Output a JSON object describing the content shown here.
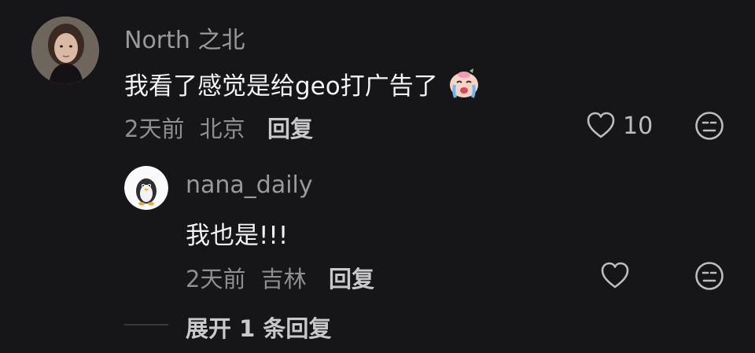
{
  "comments": [
    {
      "username": "North 之北",
      "text": "我看了感觉是给geo打广告了",
      "emoji_icon": "crying-face-emoji-icon",
      "time": "2天前",
      "location": "北京",
      "reply_label": "回复",
      "like_count": "10",
      "icons": {
        "like": "heart-outline-icon",
        "more": "expressionless-face-icon"
      }
    }
  ],
  "replies": [
    {
      "username": "nana_daily",
      "text": "我也是!!!",
      "time": "2天前",
      "location": "吉林",
      "reply_label": "回复",
      "icons": {
        "avatar": "penguin-icon",
        "like": "heart-outline-icon",
        "more": "expressionless-face-icon"
      }
    }
  ],
  "expand": {
    "label": "展开 1 条回复"
  },
  "colors": {
    "background": "#161517",
    "secondary_text": "#8f8e91",
    "primary_text": "#f2f2f2"
  }
}
